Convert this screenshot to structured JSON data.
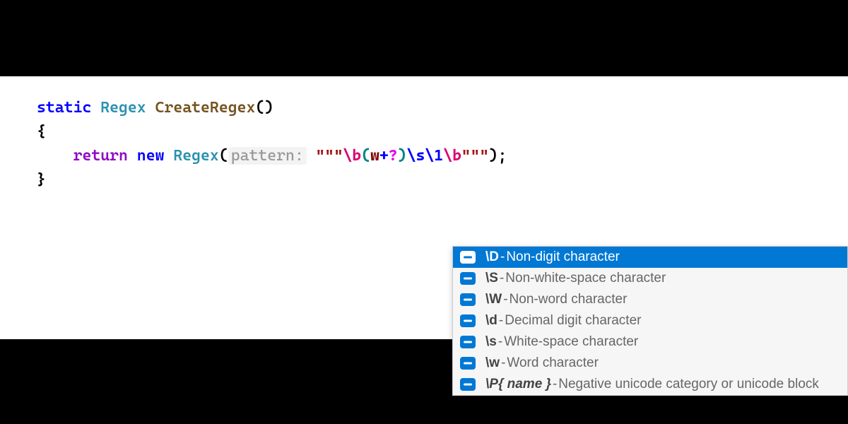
{
  "code": {
    "keyword_static": "static",
    "type_regex": "Regex",
    "method_name": "CreateRegex",
    "parens": "()",
    "brace_open": "{",
    "brace_close": "}",
    "keyword_return": "return",
    "keyword_new": "new",
    "ctor_type": "Regex",
    "paren_open": "(",
    "paren_close": ")",
    "param_hint": "pattern:",
    "quote_open": "\"\"\"",
    "quote_close": "\"\"\"",
    "regex_b1": "\\b",
    "regex_gopen": "(",
    "regex_w": "w",
    "regex_plus": "+",
    "regex_q": "?",
    "regex_gclose": ")",
    "regex_s": "\\s",
    "regex_1": "\\1",
    "regex_b2": "\\b",
    "semi": ";"
  },
  "intellisense": {
    "items": [
      {
        "token": "\\D",
        "desc": "Non-digit character",
        "selected": true,
        "italic": false
      },
      {
        "token": "\\S",
        "desc": "Non-white-space character",
        "selected": false,
        "italic": false
      },
      {
        "token": "\\W",
        "desc": "Non-word character",
        "selected": false,
        "italic": false
      },
      {
        "token": "\\d",
        "desc": "Decimal digit character",
        "selected": false,
        "italic": false
      },
      {
        "token": "\\s",
        "desc": "White-space character",
        "selected": false,
        "italic": false
      },
      {
        "token": "\\w",
        "desc": "Word character",
        "selected": false,
        "italic": false
      },
      {
        "token": "\\P{ name }",
        "desc": "Negative unicode category or unicode block",
        "selected": false,
        "italic": true
      }
    ]
  }
}
